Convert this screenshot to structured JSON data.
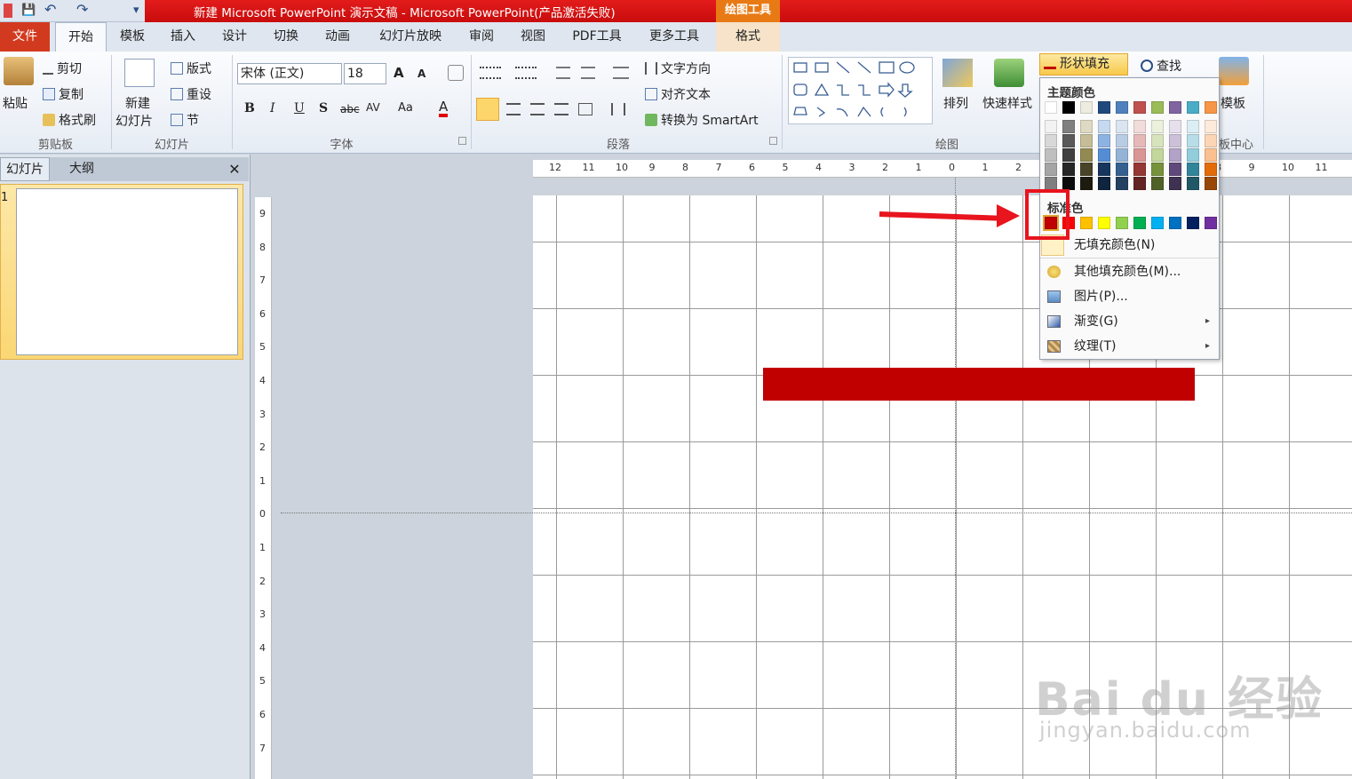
{
  "qat": {
    "save": "💾",
    "undo": "↶",
    "redo": "↷",
    "more": "▾"
  },
  "window": {
    "title": "新建 Microsoft PowerPoint 演示文稿 - Microsoft PowerPoint(产品激活失败)",
    "context_group": "绘图工具"
  },
  "tabs": {
    "file": "文件",
    "home": "开始",
    "template": "模板",
    "insert": "插入",
    "design": "设计",
    "transition": "切换",
    "animation": "动画",
    "slideshow": "幻灯片放映",
    "review": "审阅",
    "view": "视图",
    "pdf": "PDF工具",
    "more_tools": "更多工具",
    "format": "格式"
  },
  "clipboard": {
    "paste": "粘贴",
    "cut": "剪切",
    "copy": "复制",
    "format_painter": "格式刷",
    "label": "剪贴板"
  },
  "slides": {
    "new_slide_line1": "新建",
    "new_slide_line2": "幻灯片",
    "layout": "版式",
    "reset": "重设",
    "section": "节",
    "label": "幻灯片"
  },
  "font": {
    "name": "宋体 (正文)",
    "size": "18",
    "label": "字体",
    "bold": "B",
    "italic": "I",
    "underline": "U",
    "shadow": "S",
    "strike": "abc",
    "spacing": "AV",
    "case": "Aa",
    "color": "A",
    "grow": "A",
    "shrink": "A"
  },
  "paragraph": {
    "text_direction": "文字方向",
    "align_text": "对齐文本",
    "smartart": "转换为 SmartArt",
    "label": "段落"
  },
  "drawing": {
    "arrange": "排列",
    "quick_styles": "快速样式",
    "label": "绘图",
    "shape_fill": "形状填充",
    "find": "查找",
    "template_label": "模板",
    "template_center": "板中心"
  },
  "left_panel": {
    "tab_slides": "幻灯片",
    "tab_outline": "大纲",
    "close": "✕",
    "slide_number": "1"
  },
  "ruler_h": [
    "12",
    "11",
    "10",
    "9",
    "8",
    "7",
    "6",
    "5",
    "4",
    "3",
    "2",
    "1",
    "0",
    "1",
    "2",
    "3",
    "4",
    "5",
    "6",
    "7",
    "8",
    "9",
    "10",
    "11"
  ],
  "ruler_v": [
    "9",
    "8",
    "7",
    "6",
    "5",
    "4",
    "3",
    "2",
    "1",
    "0",
    "1",
    "2",
    "3",
    "4",
    "5",
    "6",
    "7"
  ],
  "fill_menu": {
    "theme_colors_label": "主题颜色",
    "theme_top": [
      "#ffffff",
      "#000000",
      "#eeece1",
      "#1f497d",
      "#4f81bd",
      "#c0504d",
      "#9bbb59",
      "#8064a2",
      "#4bacc6",
      "#f79646"
    ],
    "theme_shades": [
      [
        "#f2f2f2",
        "#7f7f7f",
        "#ddd9c3",
        "#c6d9f0",
        "#dbe5f1",
        "#f2dcdb",
        "#ebf1dd",
        "#e5e0ec",
        "#dbeef3",
        "#fdeada"
      ],
      [
        "#d8d8d8",
        "#595959",
        "#c4bd97",
        "#8db3e2",
        "#b8cce4",
        "#e5b9b7",
        "#d7e3bc",
        "#ccc1d9",
        "#b7dde8",
        "#fbd5b5"
      ],
      [
        "#bfbfbf",
        "#3f3f3f",
        "#938953",
        "#548dd4",
        "#95b3d7",
        "#d99694",
        "#c3d69b",
        "#b2a2c7",
        "#92cddc",
        "#fac08f"
      ],
      [
        "#a5a5a5",
        "#262626",
        "#494429",
        "#17365d",
        "#366092",
        "#953734",
        "#76923c",
        "#5f497a",
        "#31859b",
        "#e36c09"
      ],
      [
        "#7f7f7f",
        "#0c0c0c",
        "#1d1b10",
        "#0f243e",
        "#244061",
        "#632423",
        "#4f6128",
        "#3f3151",
        "#205867",
        "#974806"
      ]
    ],
    "standard_colors_label": "标准色",
    "standard": [
      "#c00000",
      "#ff0000",
      "#ffc000",
      "#ffff00",
      "#92d050",
      "#00b050",
      "#00b0f0",
      "#0070c0",
      "#002060",
      "#7030a0"
    ],
    "no_fill": "无填充颜色(N)",
    "more_colors": "其他填充颜色(M)...",
    "picture": "图片(P)...",
    "gradient": "渐变(G)",
    "texture": "纹理(T)",
    "submenu_arrow": "▸"
  },
  "shape": {
    "fill_color": "#c00000"
  },
  "watermark": {
    "line1": "Bai du 经验",
    "line2": "jingyan.baidu.com"
  }
}
